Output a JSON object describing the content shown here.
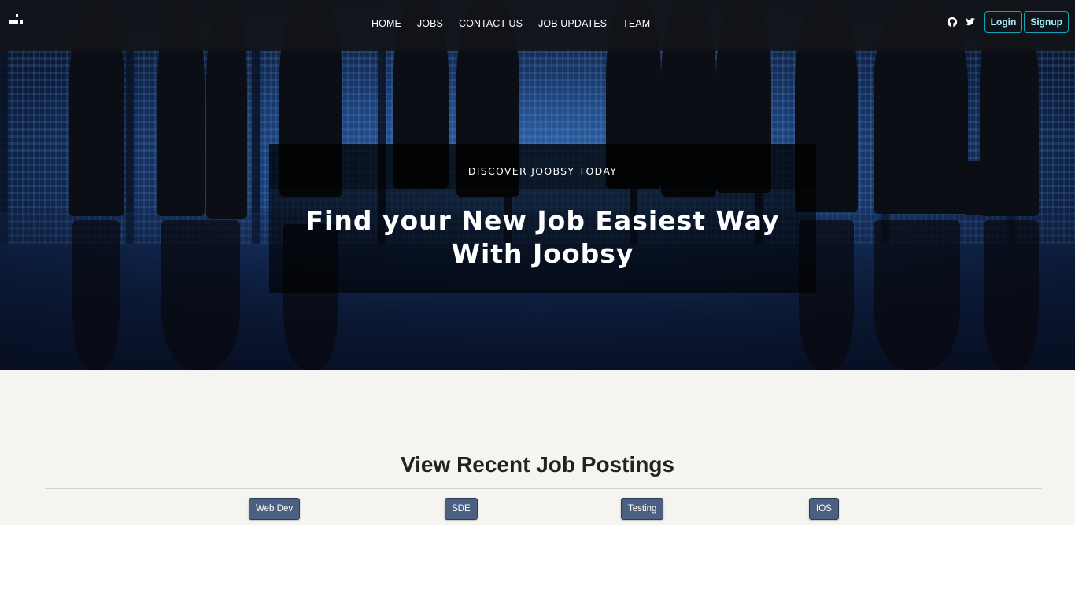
{
  "nav": {
    "links": [
      "HOME",
      "JOBS",
      "CONTACT US",
      "JOB UPDATES",
      "TEAM"
    ],
    "login_label": "Login",
    "signup_label": "Signup",
    "icons": [
      "github-icon",
      "twitter-icon"
    ]
  },
  "hero": {
    "eyebrow": "DISCOVER JOOBSY TODAY",
    "headline": "Find your New Job Easiest Way With Joobsy"
  },
  "postings": {
    "title": "View Recent Job Postings",
    "categories": [
      "Web Dev",
      "SDE",
      "Testing",
      "IOS"
    ]
  },
  "colors": {
    "accent": "#17a2b8",
    "category_button": "#4b5f80",
    "section_bg": "#f5f4f0"
  }
}
